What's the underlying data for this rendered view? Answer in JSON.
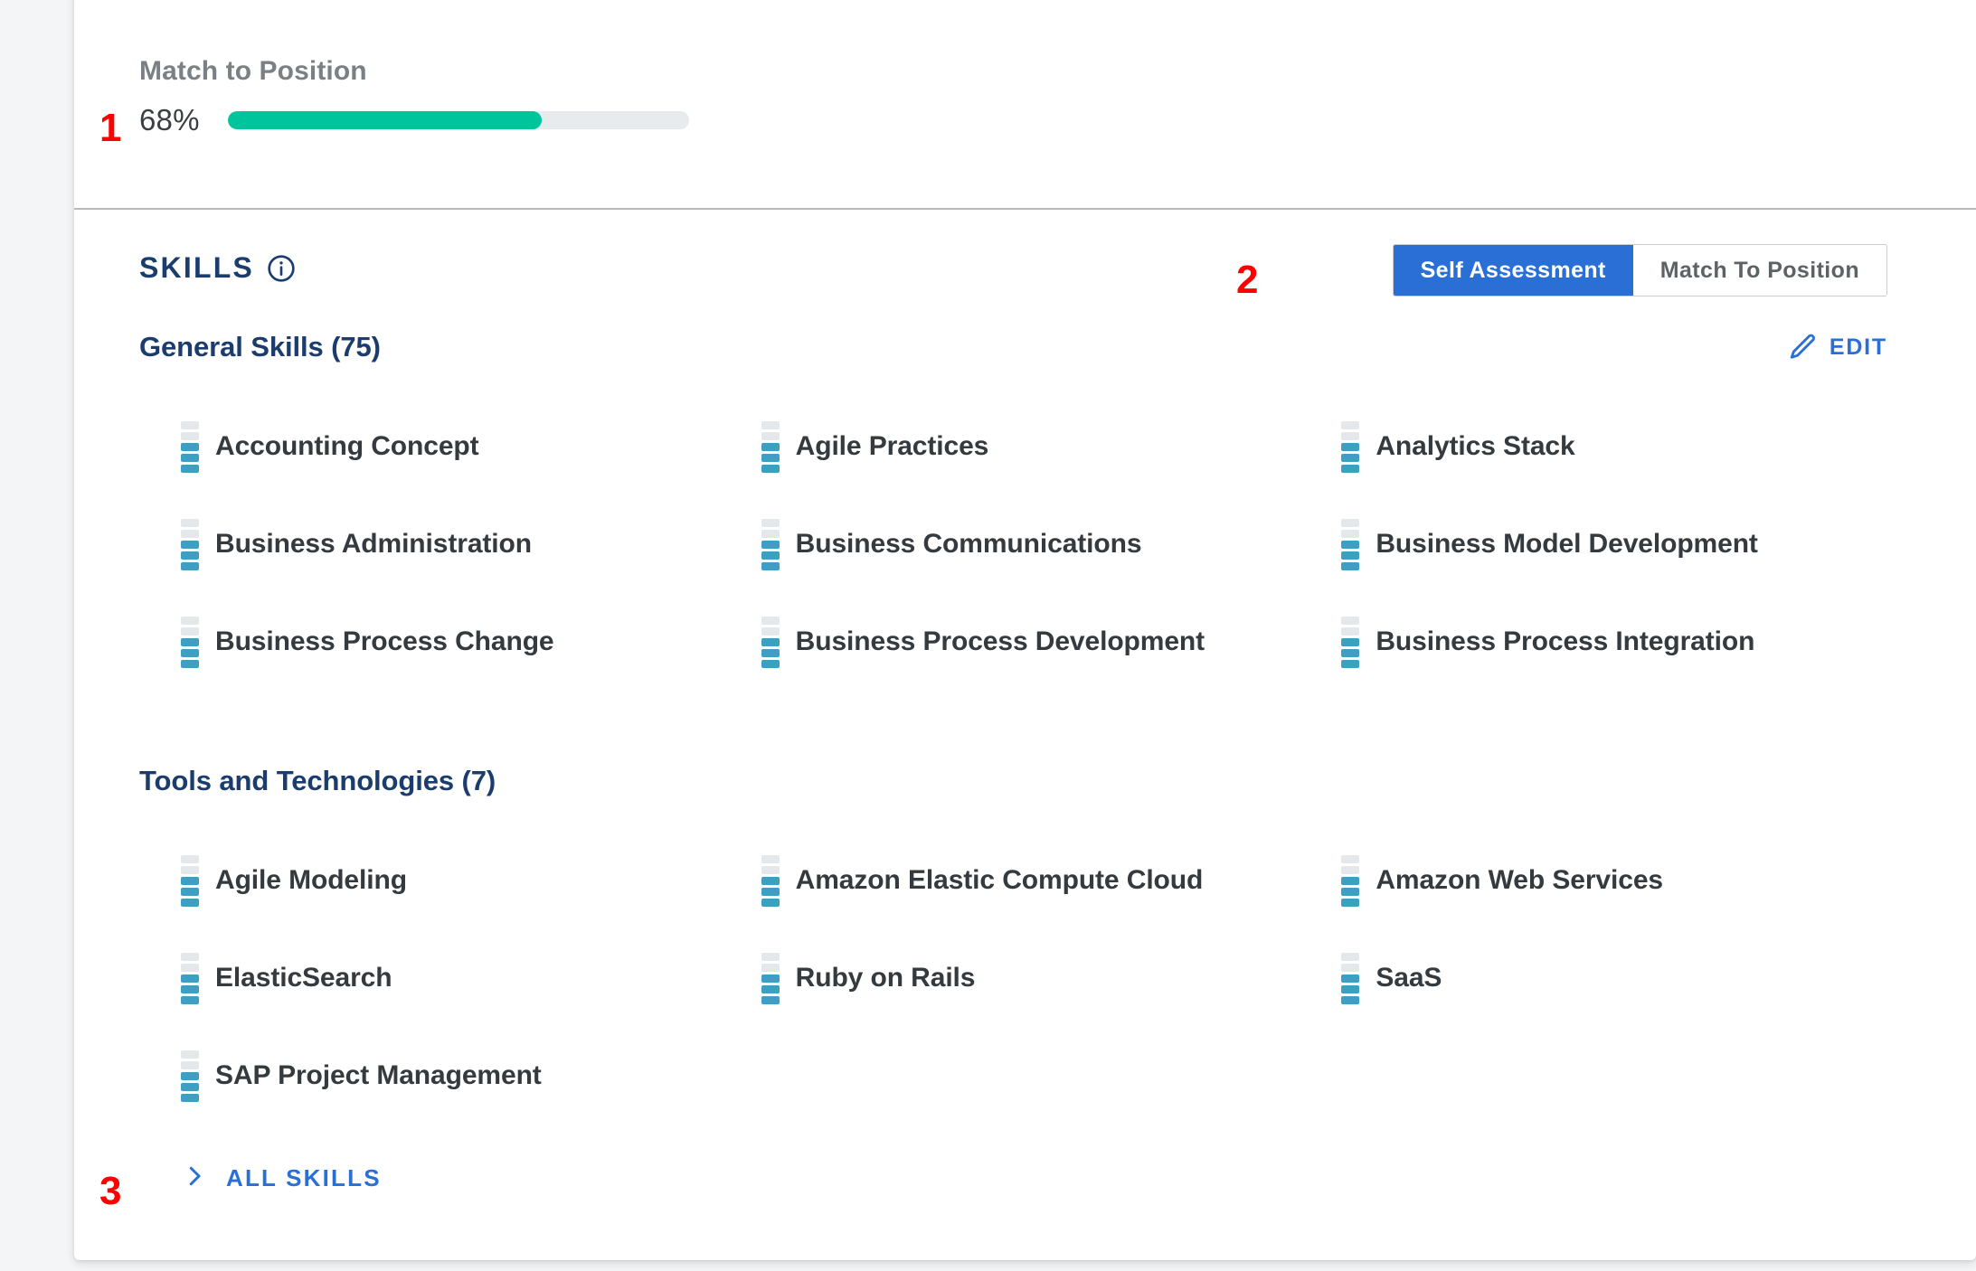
{
  "match": {
    "label": "Match to Position",
    "percent_text": "68%",
    "percent_value": 68,
    "fill_color": "#00c49c",
    "track_color": "#e8ebed"
  },
  "skills_header": {
    "title": "SKILLS",
    "info_icon": "info-circle-icon",
    "toggle": {
      "options": [
        {
          "label": "Self Assessment",
          "active": true
        },
        {
          "label": "Match To Position",
          "active": false
        }
      ],
      "active_color": "#2a6fd6"
    }
  },
  "groups": [
    {
      "title": "General Skills (75)",
      "edit": {
        "label": "EDIT",
        "icon": "pencil-icon",
        "color": "#2a6fd6"
      },
      "skills": [
        {
          "name": "Accounting Concept",
          "level": 3,
          "max_level": 5
        },
        {
          "name": "Agile Practices",
          "level": 3,
          "max_level": 5
        },
        {
          "name": "Analytics Stack",
          "level": 3,
          "max_level": 5
        },
        {
          "name": "Business Administration",
          "level": 3,
          "max_level": 5
        },
        {
          "name": "Business Communications",
          "level": 3,
          "max_level": 5
        },
        {
          "name": "Business Model Development",
          "level": 3,
          "max_level": 5
        },
        {
          "name": "Business Process Change",
          "level": 3,
          "max_level": 5
        },
        {
          "name": "Business Process Development",
          "level": 3,
          "max_level": 5
        },
        {
          "name": "Business Process Integration",
          "level": 3,
          "max_level": 5
        }
      ]
    },
    {
      "title": "Tools and Technologies (7)",
      "edit": null,
      "skills": [
        {
          "name": "Agile Modeling",
          "level": 3,
          "max_level": 5
        },
        {
          "name": "Amazon Elastic Compute Cloud",
          "level": 3,
          "max_level": 5
        },
        {
          "name": "Amazon Web Services",
          "level": 3,
          "max_level": 5
        },
        {
          "name": "ElasticSearch",
          "level": 3,
          "max_level": 5
        },
        {
          "name": "Ruby on Rails",
          "level": 3,
          "max_level": 5
        },
        {
          "name": "SaaS",
          "level": 3,
          "max_level": 5
        },
        {
          "name": "SAP Project Management",
          "level": 3,
          "max_level": 5
        }
      ]
    }
  ],
  "all_skills": {
    "label": "ALL SKILLS",
    "icon": "chevron-right-icon"
  },
  "annotations": [
    {
      "id": "1",
      "text": "1"
    },
    {
      "id": "2",
      "text": "2"
    },
    {
      "id": "3",
      "text": "3"
    }
  ],
  "colors": {
    "skill_filled": "#3d9fc4",
    "skill_empty": "#e4e8eb",
    "heading_navy": "#1b3d6d",
    "link_blue": "#2a6fd6",
    "annotation_red": "#ff0000"
  }
}
